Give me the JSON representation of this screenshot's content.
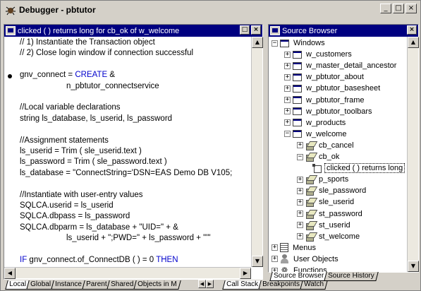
{
  "window": {
    "title": "Debugger - pbtutor",
    "minimize": "_",
    "maximize": "□",
    "close": "×"
  },
  "source_pane": {
    "header": "clicked ( ) returns long for cb_ok of w_welcome",
    "restore": "□",
    "close": "×",
    "lines": [
      {
        "text": "// 1) Instantiate the Transaction object",
        "breakpoint": false
      },
      {
        "text": "// 2) Close login window if connection successful",
        "breakpoint": false
      },
      {
        "text": "",
        "breakpoint": false
      },
      {
        "text": "gnv_connect = CREATE &",
        "breakpoint": true
      },
      {
        "text": "n_pbtutor_connectservice",
        "breakpoint": false
      },
      {
        "text": "",
        "breakpoint": false
      },
      {
        "text": "//Local variable declarations",
        "breakpoint": false
      },
      {
        "text": "string ls_database, ls_userid, ls_password",
        "breakpoint": false
      },
      {
        "text": "",
        "breakpoint": false
      },
      {
        "text": "//Assignment statements",
        "breakpoint": false
      },
      {
        "text": "ls_userid = Trim ( sle_userid.text )",
        "breakpoint": false
      },
      {
        "text": "ls_password = Trim ( sle_password.text )",
        "breakpoint": false
      },
      {
        "text": "ls_database = \"ConnectString='DSN=EAS Demo DB V105;",
        "breakpoint": false
      },
      {
        "text": "",
        "breakpoint": false
      },
      {
        "text": "//Instantiate with user-entry values",
        "breakpoint": false
      },
      {
        "text": "SQLCA.userid = ls_userid",
        "breakpoint": false
      },
      {
        "text": "SQLCA.dbpass = ls_password",
        "breakpoint": false
      },
      {
        "text": "SQLCA.dbparm = ls_database + \"UID=\" + &",
        "breakpoint": false
      },
      {
        "text": "ls_userid + \";PWD=\" + ls_password + \"'\"",
        "breakpoint": false
      },
      {
        "text": "",
        "breakpoint": false
      },
      {
        "text": "IF gnv_connect.of_ConnectDB ( ) = 0 THEN",
        "breakpoint": false
      }
    ],
    "tabs": [
      "Local",
      "Global",
      "Instance",
      "Parent",
      "Shared",
      "Objects in M"
    ]
  },
  "bottom_tabs": [
    "Call Stack",
    "Breakpoints",
    "Watch"
  ],
  "browser_pane": {
    "header": "Source Browser",
    "close": "×",
    "tree": [
      {
        "label": "Windows",
        "depth": 0,
        "exp": "−",
        "icon": "window-icon"
      },
      {
        "label": "w_customers",
        "depth": 1,
        "exp": "+",
        "icon": "window-icon"
      },
      {
        "label": "w_master_detail_ancestor",
        "depth": 1,
        "exp": "+",
        "icon": "window-icon"
      },
      {
        "label": "w_pbtutor_about",
        "depth": 1,
        "exp": "+",
        "icon": "window-icon"
      },
      {
        "label": "w_pbtutor_basesheet",
        "depth": 1,
        "exp": "+",
        "icon": "window-icon"
      },
      {
        "label": "w_pbtutor_frame",
        "depth": 1,
        "exp": "+",
        "icon": "window-icon"
      },
      {
        "label": "w_pbtutor_toolbars",
        "depth": 1,
        "exp": "+",
        "icon": "window-icon"
      },
      {
        "label": "w_products",
        "depth": 1,
        "exp": "+",
        "icon": "window-icon"
      },
      {
        "label": "w_welcome",
        "depth": 1,
        "exp": "−",
        "icon": "window-icon"
      },
      {
        "label": "cb_cancel",
        "depth": 2,
        "exp": "+",
        "icon": "control-icon"
      },
      {
        "label": "cb_ok",
        "depth": 2,
        "exp": "−",
        "icon": "control-icon"
      },
      {
        "label": "clicked ( ) returns long",
        "depth": 3,
        "exp": "",
        "icon": "event-icon",
        "selected": true
      },
      {
        "label": "p_sports",
        "depth": 2,
        "exp": "+",
        "icon": "control-icon"
      },
      {
        "label": "sle_password",
        "depth": 2,
        "exp": "+",
        "icon": "control-icon"
      },
      {
        "label": "sle_userid",
        "depth": 2,
        "exp": "+",
        "icon": "control-icon"
      },
      {
        "label": "st_password",
        "depth": 2,
        "exp": "+",
        "icon": "control-icon"
      },
      {
        "label": "st_userid",
        "depth": 2,
        "exp": "+",
        "icon": "control-icon"
      },
      {
        "label": "st_welcome",
        "depth": 2,
        "exp": "+",
        "icon": "control-icon"
      },
      {
        "label": "Menus",
        "depth": 0,
        "exp": "+",
        "icon": "menu-icon"
      },
      {
        "label": "User Objects",
        "depth": 0,
        "exp": "+",
        "icon": "user-icon"
      },
      {
        "label": "Functions",
        "depth": 0,
        "exp": "+",
        "icon": "function-icon"
      }
    ],
    "tabs": [
      "Source Browser",
      "Source History"
    ]
  },
  "colors": {
    "keyword": "#0000cc",
    "titlebar": "#000080",
    "face": "#d4d0c8"
  }
}
